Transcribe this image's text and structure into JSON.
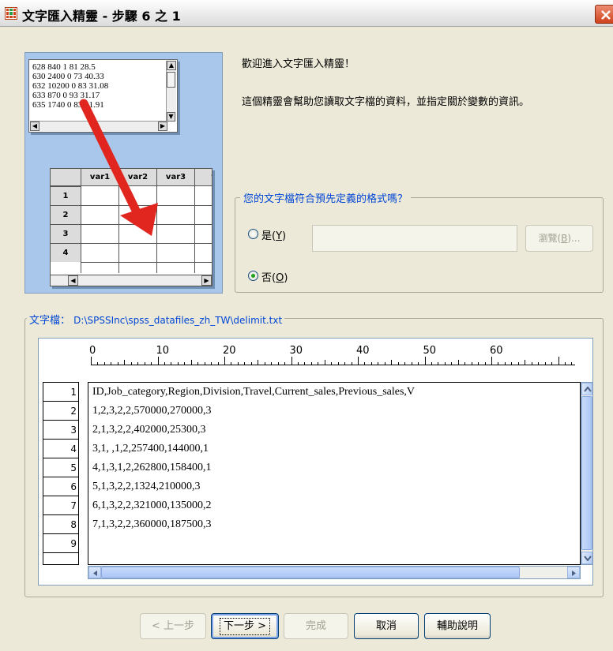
{
  "window": {
    "title": "文字匯入精靈 - 步驟 6 之 1"
  },
  "illustration": {
    "text_lines": [
      "628 840 1 81 28.5",
      "630 2400 0 73 40.33",
      "632 10200 0 83 31.08",
      "633 870 0 93 31.17",
      "635 1740 0 83 41.91"
    ],
    "columns": [
      "var1",
      "var2",
      "var3",
      "v"
    ],
    "rows": [
      "1",
      "2",
      "3",
      "4"
    ],
    "arrow_color": "#e0261e"
  },
  "intro": {
    "welcome": "歡迎進入文字匯入精靈！",
    "description": "這個精靈會幫助您讀取文字檔的資料，並指定關於變數的資訊。"
  },
  "format_question": {
    "legend": "您的文字檔符合預先定義的格式嗎？",
    "yes_label": "是(",
    "yes_key": "Y",
    "no_label": "否(",
    "no_key": "O",
    "selected": "no",
    "path_value": "",
    "browse_label": "瀏覽(",
    "browse_key": "B",
    "browse_suffix": ")..."
  },
  "file": {
    "label": "文字檔：",
    "path": "D:\\SPSSInc\\spss_datafiles_zh_TW\\delimit.txt",
    "ruler_numbers": [
      "0",
      "10",
      "20",
      "30",
      "40",
      "50",
      "60"
    ],
    "row_numbers": [
      "1",
      "2",
      "3",
      "4",
      "5",
      "6",
      "7",
      "8",
      "9"
    ],
    "lines": [
      "ID,Job_category,Region,Division,Travel,Current_sales,Previous_sales,V",
      "1,2,3,2,2,570000,270000,3",
      "2,1,3,2,2,402000,25300,3",
      "3,1, ,1,2,257400,144000,1",
      "4,1,3,1,2,262800,158400,1",
      "5,1,3,2,2,1324,210000,3",
      "6,1,3,2,2,321000,135000,2",
      "7,1,3,2,2,360000,187500,3",
      ""
    ]
  },
  "buttons": {
    "back": "< 上一步",
    "next": "下一步 >",
    "finish": "完成",
    "cancel": "取消",
    "help": "輔助說明"
  },
  "colors": {
    "accent_blue": "#0046d5",
    "dialog_bg": "#ece9d8",
    "illustration_bg": "#a9c7ea"
  }
}
